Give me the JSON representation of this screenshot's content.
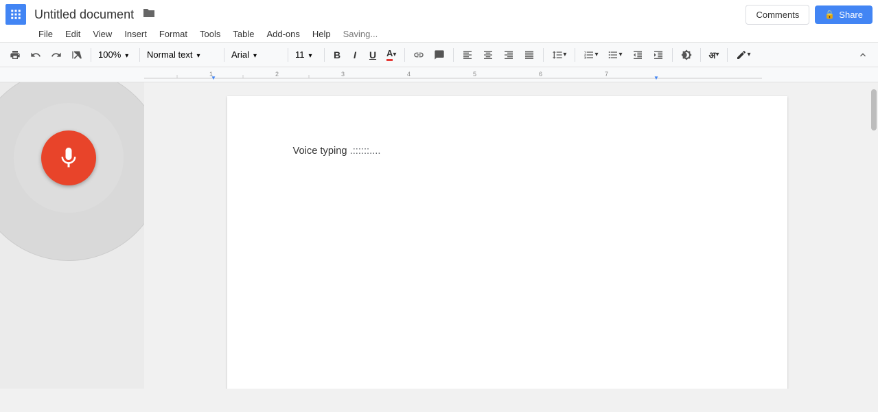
{
  "header": {
    "app_icon_label": "Google Apps",
    "doc_title": "Untitled document",
    "folder_icon": "📁",
    "comments_label": "Comments",
    "share_label": "Share",
    "saving_label": "Saving..."
  },
  "menu": {
    "items": [
      "File",
      "Edit",
      "View",
      "Insert",
      "Format",
      "Tools",
      "Table",
      "Add-ons",
      "Help"
    ]
  },
  "toolbar": {
    "zoom": "100%",
    "style": "Normal text",
    "font": "Arial",
    "font_size": "11",
    "bold_label": "B",
    "italic_label": "I",
    "underline_label": "U"
  },
  "document": {
    "content": "Voice typing",
    "voice_typing_dots": " .::::::...."
  },
  "voice_panel": {
    "mic_label": "Start voice typing"
  }
}
